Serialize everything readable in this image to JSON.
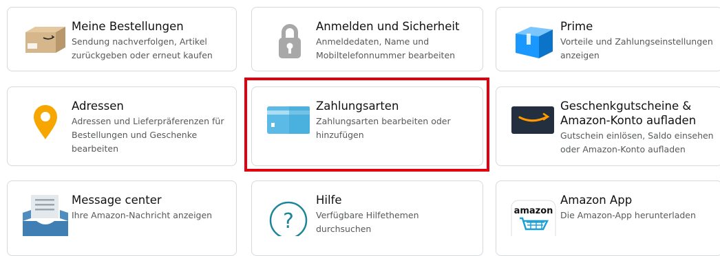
{
  "cards": [
    {
      "title": "Meine Bestellungen",
      "desc": "Sendung nachverfolgen, Artikel zurückgeben oder erneut kaufen",
      "icon": "package-icon"
    },
    {
      "title": "Anmelden und Sicherheit",
      "desc": "Anmeldedaten, Name und Mobiltelefonnummer bearbeiten",
      "icon": "lock-icon"
    },
    {
      "title": "Prime",
      "desc": "Vorteile und Zahlungseinstellungen anzeigen",
      "icon": "prime-box-icon"
    },
    {
      "title": "Adressen",
      "desc": "Adressen und Lieferpräferenzen für Bestellungen und Geschenke bearbeiten",
      "icon": "map-pin-icon"
    },
    {
      "title": "Zahlungsarten",
      "desc": "Zahlungsarten bearbeiten oder hinzufügen",
      "icon": "credit-card-icon"
    },
    {
      "title": "Geschenkgutscheine & Amazon-Konto aufladen",
      "desc": "Gutschein einlösen, Saldo einsehen oder Amazon-Konto aufladen",
      "icon": "gift-card-icon"
    },
    {
      "title": "Message center",
      "desc": "Ihre Amazon-Nachricht anzeigen",
      "icon": "inbox-icon"
    },
    {
      "title": "Hilfe",
      "desc": "Verfügbare Hilfethemen durchsuchen",
      "icon": "help-icon"
    },
    {
      "title": "Amazon App",
      "desc": "Die Amazon-App herunterladen",
      "icon": "amazon-app-icon"
    }
  ],
  "icon_labels": {
    "amazon_app_logo": "amazon"
  },
  "colors": {
    "highlight": "#e2000f",
    "card_border": "#d5d9d9",
    "desc_text": "#565959",
    "amazon_orange": "#ff9900",
    "prime_blue": "#1a98ff",
    "card_blue": "#5bbbe6",
    "help_teal": "#1d8597"
  }
}
